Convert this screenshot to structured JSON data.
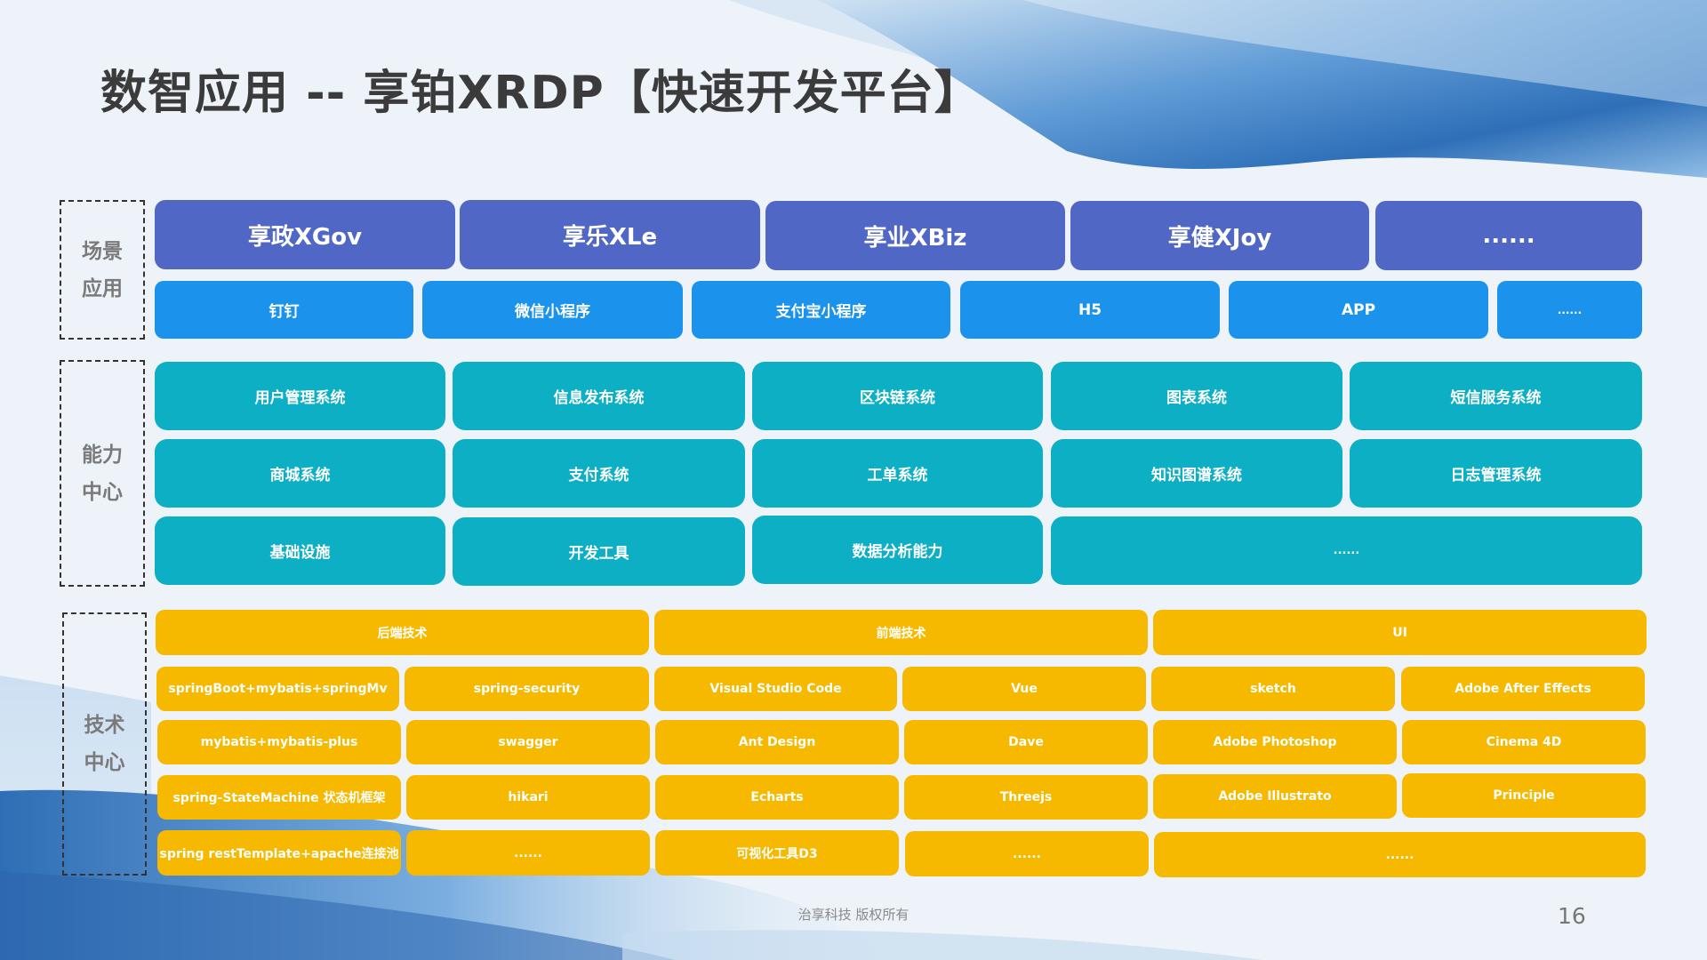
{
  "title": "数智应用 -- 享铂XRDP【快速开发平台】",
  "sections": {
    "scene": {
      "label_line1": "场景",
      "label_line2": "应用"
    },
    "capability": {
      "label_line1": "能力",
      "label_line2": "中心"
    },
    "tech": {
      "label_line1": "技术",
      "label_line2": "中心"
    }
  },
  "scene_products": [
    "享政XGov",
    "享乐XLe",
    "享业XBiz",
    "享健XJoy",
    "......"
  ],
  "channels": [
    "钉钉",
    "微信小程序",
    "支付宝小程序",
    "H5",
    "APP",
    "......"
  ],
  "capabilities": [
    [
      "用户管理系统",
      "信息发布系统",
      "区块链系统",
      "图表系统",
      "短信服务系统"
    ],
    [
      "商城系统",
      "支付系统",
      "工单系统",
      "知识图谱系统",
      "日志管理系统"
    ],
    [
      "基础设施",
      "开发工具",
      "数据分析能力",
      "......"
    ]
  ],
  "tech_categories": [
    "后端技术",
    "前端技术",
    "UI"
  ],
  "tech_items": [
    [
      "springBoot+mybatis+springMv",
      "spring-security",
      "Visual Studio Code",
      "Vue",
      "sketch",
      "Adobe After Effects"
    ],
    [
      "mybatis+mybatis-plus",
      "swagger",
      "Ant Design",
      "Dave",
      "Adobe Photoshop",
      "Cinema 4D"
    ],
    [
      "spring-StateMachine 状态机框架",
      "hikari",
      "Echarts",
      "Threejs",
      "Adobe Illustrato",
      "Principle"
    ],
    [
      "spring restTemplate+apache连接池",
      "......",
      "可视化工具D3",
      "......",
      "......"
    ]
  ],
  "footer": {
    "copyright": "治享科技 版权所有",
    "page_number": "16"
  },
  "colors": {
    "scene": "#5067c6",
    "channel": "#1b93ec",
    "capability": "#0dafc4",
    "tech": "#f6b900",
    "background": "#edf3f8"
  }
}
